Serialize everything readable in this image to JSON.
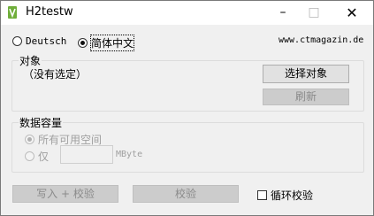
{
  "window": {
    "title": "H2testw"
  },
  "language": {
    "options": [
      {
        "label": "Deutsch",
        "selected": false
      },
      {
        "label": "简体中文",
        "selected": true
      }
    ]
  },
  "website": "www.ctmagazin.de",
  "target_group": {
    "title": "对象",
    "status": "（没有选定）",
    "select_label": "选择对象",
    "refresh_label": "刷新"
  },
  "capacity_group": {
    "title": "数据容量",
    "all_space_label": "所有可用空间",
    "only_label": "仅",
    "amount_value": "",
    "unit": "MByte"
  },
  "actions": {
    "write_verify_label": "写入 + 校验",
    "verify_label": "校验",
    "loop_label": "循环校验",
    "loop_checked": false
  },
  "colors": {
    "disabled_text": "#8a8a8a",
    "disabled_button": "#cccccc"
  }
}
